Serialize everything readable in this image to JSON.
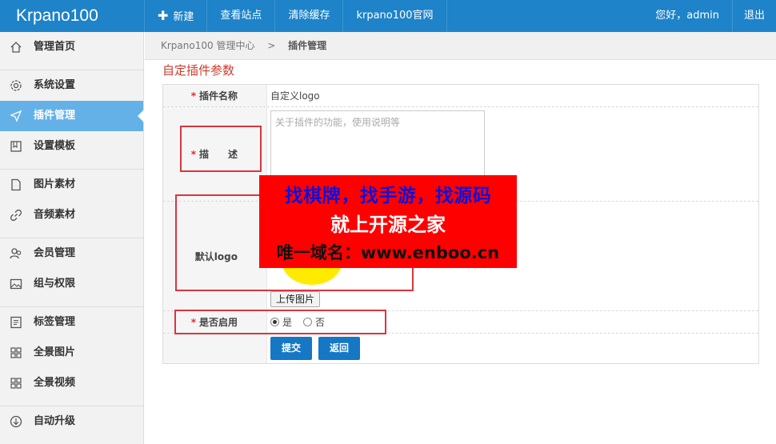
{
  "app": {
    "title": "Krpano100"
  },
  "topnav": {
    "new_label": "新建",
    "view_site": "查看站点",
    "clear_cache": "清除缓存",
    "official": "krpano100官网",
    "greeting": "您好，admin",
    "logout": "退出"
  },
  "sidebar": {
    "items": [
      {
        "label": "管理首页",
        "icon": "home-icon"
      },
      {
        "label": "系统设置",
        "icon": "gear-icon"
      },
      {
        "label": "插件管理",
        "icon": "navigation-arrow-icon"
      },
      {
        "label": "设置模板",
        "icon": "book-icon"
      },
      {
        "label": "图片素材",
        "icon": "file-icon"
      },
      {
        "label": "音频素材",
        "icon": "link-icon"
      },
      {
        "label": "会员管理",
        "icon": "users-icon"
      },
      {
        "label": "组与权限",
        "icon": "picture-icon"
      },
      {
        "label": "标签管理",
        "icon": "list-icon"
      },
      {
        "label": "全景图片",
        "icon": "grid-icon"
      },
      {
        "label": "全景视频",
        "icon": "grid-icon"
      },
      {
        "label": "自动升级",
        "icon": "download-circle-icon"
      }
    ],
    "active": "插件管理"
  },
  "breadcrumb": {
    "root": "Krpano100 管理中心",
    "separator": ">",
    "current": "插件管理"
  },
  "section_title": "自定插件参数",
  "form": {
    "name_label": "插件名称",
    "name_value": "自定义logo",
    "desc_label": "描　　述",
    "desc_placeholder": "关于插件的功能，使用说明等",
    "logo_label": "默认logo",
    "upload_label": "上传图片",
    "enable_label": "是否启用",
    "opt_yes": "是",
    "opt_no": "否",
    "submit": "提交",
    "back": "返回",
    "required_mark": "*"
  },
  "watermark": {
    "line1": "找棋牌，找手游，找源码",
    "line2": "就上开源之家",
    "line3": "唯一域名：www.enboo.cn"
  },
  "colors": {
    "topbar": "#1e83c8",
    "active": "#64b1e8",
    "primary_button": "#1677c4",
    "annotation": "#d9363e"
  }
}
